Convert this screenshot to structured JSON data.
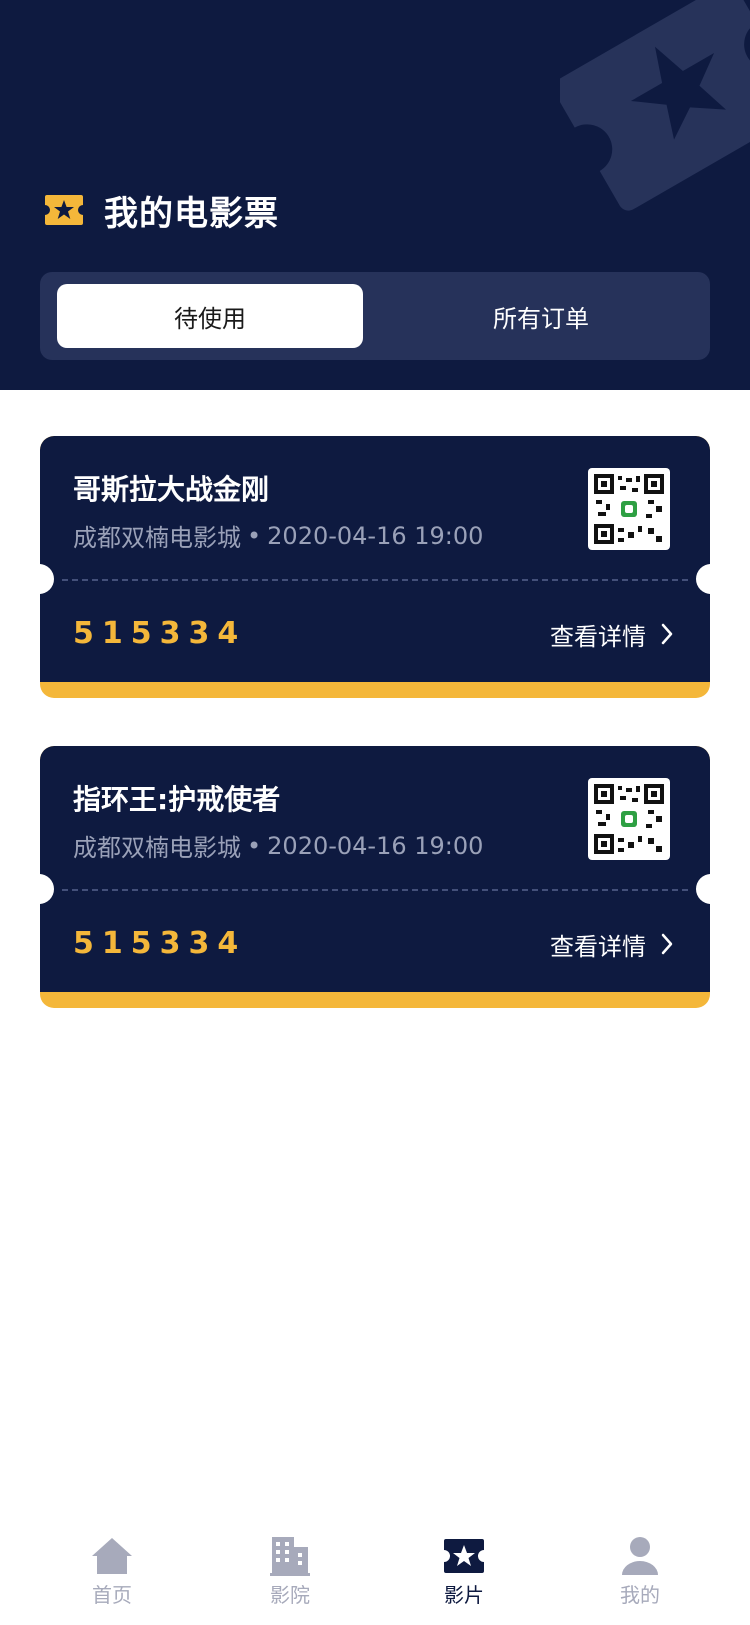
{
  "header": {
    "title": "我的电影票",
    "ticket_icon": "ticket-star-icon",
    "decor_icon": "ticket-decoration-icon"
  },
  "tabs": [
    {
      "label": "待使用",
      "active": true
    },
    {
      "label": "所有订单",
      "active": false
    }
  ],
  "tickets": [
    {
      "title": "哥斯拉大战金刚",
      "cinema": "成都双楠电影城",
      "separator": "•",
      "datetime": "2020-04-16 19:00",
      "code": "515334",
      "details_label": "查看详情"
    },
    {
      "title": "指环王:护戒使者",
      "cinema": "成都双楠电影城",
      "separator": "•",
      "datetime": "2020-04-16 19:00",
      "code": "515334",
      "details_label": "查看详情"
    }
  ],
  "nav": [
    {
      "label": "首页",
      "icon": "home-icon",
      "active": false
    },
    {
      "label": "影院",
      "icon": "building-icon",
      "active": false
    },
    {
      "label": "影片",
      "icon": "movie-ticket-icon",
      "active": true
    },
    {
      "label": "我的",
      "icon": "user-icon",
      "active": false
    }
  ],
  "colors": {
    "navy": "#0e1a40",
    "tab_bg": "#26325a",
    "accent": "#f4b73a",
    "muted": "#9aa1b8",
    "nav_inactive": "#a7aabb"
  }
}
